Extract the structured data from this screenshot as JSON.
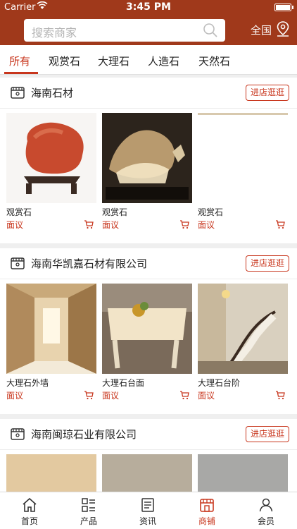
{
  "status_bar": {
    "carrier": "Carrier",
    "time": "3:45 PM"
  },
  "header": {
    "search_placeholder": "搜索商家",
    "region": "全国",
    "background_color": "#a0391b",
    "accent_color": "#c8361d"
  },
  "tabs": [
    {
      "label": "所有",
      "active": true
    },
    {
      "label": "观赏石",
      "active": false
    },
    {
      "label": "大理石",
      "active": false
    },
    {
      "label": "人造石",
      "active": false
    },
    {
      "label": "天然石",
      "active": false
    }
  ],
  "stores": [
    {
      "name": "海南石材",
      "enter_label": "进店逛逛",
      "products": [
        {
          "name": "观赏石",
          "price": "面议",
          "image": "red ornamental stone on wooden stand"
        },
        {
          "name": "观赏石",
          "price": "面议",
          "image": "lit ornamental stone landscape"
        },
        {
          "name": "观赏石",
          "price": "面议",
          "image": "blank image"
        }
      ]
    },
    {
      "name": "海南华凯嘉石材有限公司",
      "enter_label": "进店逛逛",
      "products": [
        {
          "name": "大理石外墙",
          "price": "面议",
          "image": "marble wall hallway"
        },
        {
          "name": "大理石台面",
          "price": "面议",
          "image": "marble table top"
        },
        {
          "name": "大理石台阶",
          "price": "面议",
          "image": "marble staircase"
        }
      ]
    },
    {
      "name": "海南闽琼石业有限公司",
      "enter_label": "进店逛逛",
      "products": [
        {
          "image": "beige stone texture"
        },
        {
          "image": "terrazzo stone texture"
        },
        {
          "image": "grey stone texture"
        }
      ]
    }
  ],
  "tabbar": [
    {
      "label": "首页",
      "icon": "home-icon",
      "active": false
    },
    {
      "label": "产品",
      "icon": "grid-list-icon",
      "active": false
    },
    {
      "label": "资讯",
      "icon": "news-icon",
      "active": false
    },
    {
      "label": "商铺",
      "icon": "shop-icon",
      "active": true
    },
    {
      "label": "会员",
      "icon": "user-icon",
      "active": false
    }
  ]
}
